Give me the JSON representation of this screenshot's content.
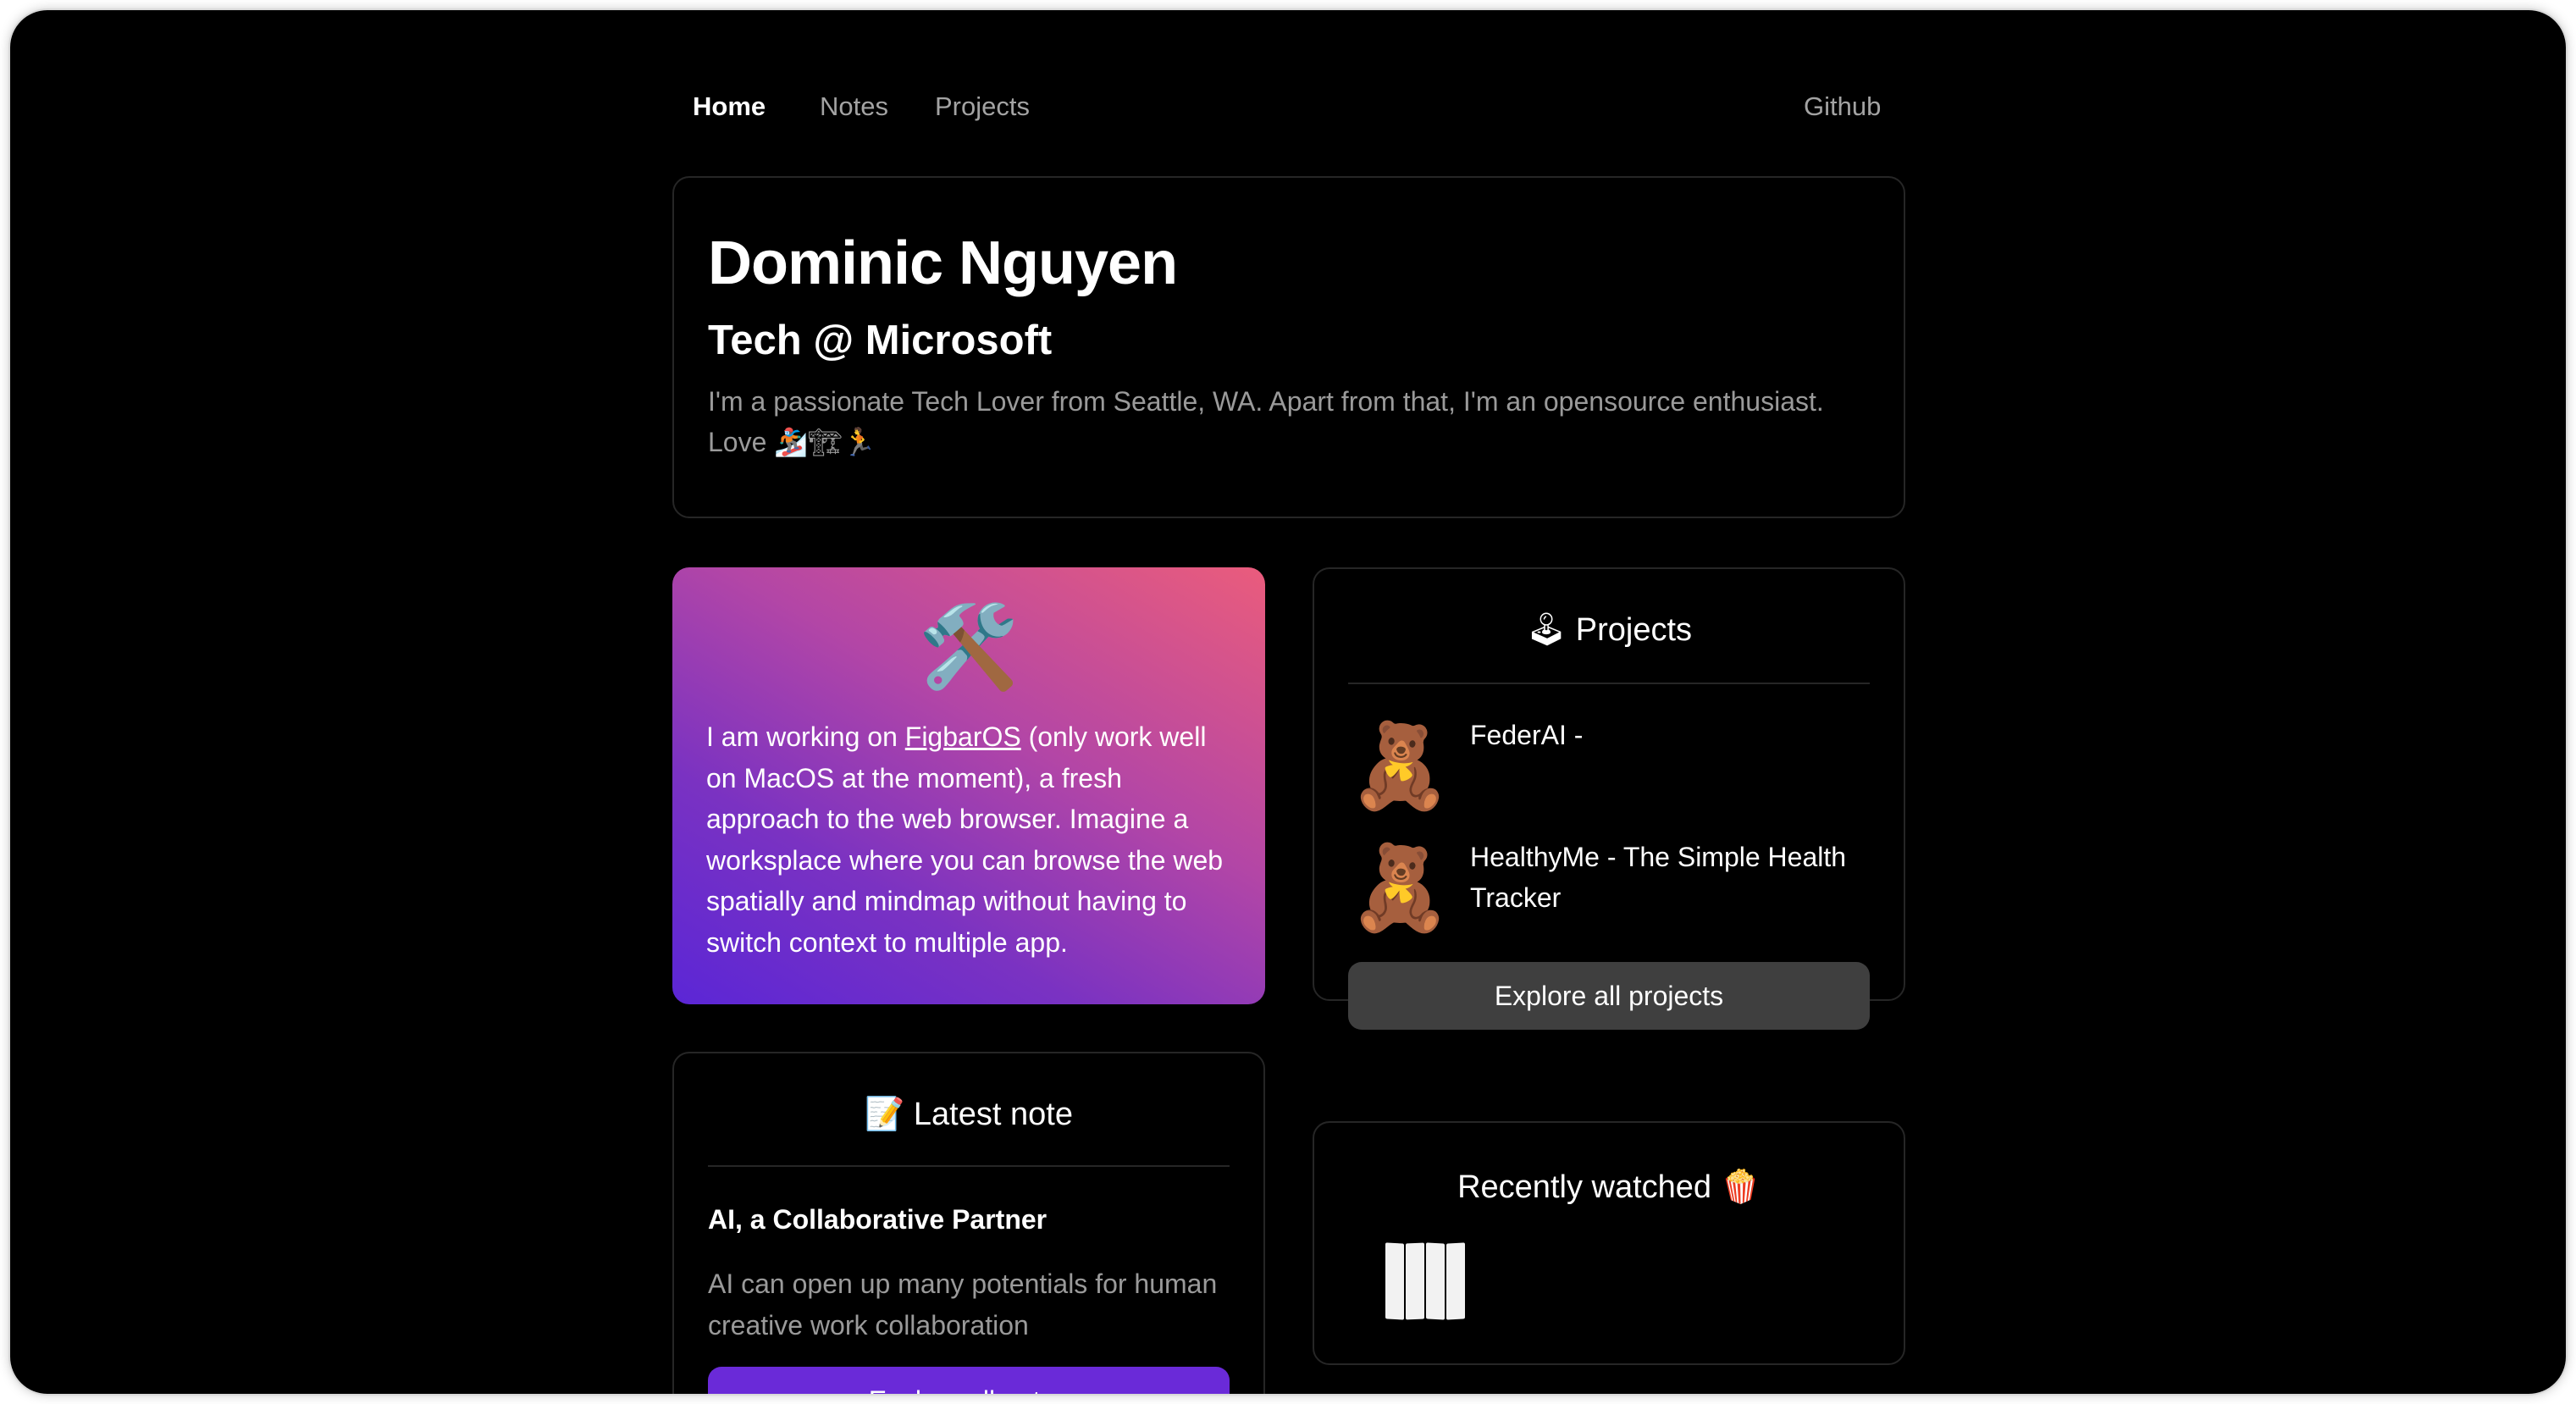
{
  "nav": {
    "links": [
      "Home",
      "Notes",
      "Projects"
    ],
    "github": "Github"
  },
  "hero": {
    "name": "Dominic Nguyen",
    "role": "Tech @ Microsoft",
    "bio": "I'm a passionate Tech Lover from Seattle, WA. Apart from that, I'm an opensource enthusiast. Love 🏂🏗🏃"
  },
  "figbar": {
    "icon": "🛠️",
    "text_before": "I am working on ",
    "link": "FigbarOS",
    "text_after": " (only work well on MacOS at the moment), a fresh approach to the web browser. Imagine a worksplace where you can browse the web spatially and mindmap without having to switch context to multiple app.",
    "gradient": [
      "#5b26d6",
      "#ea5c7c"
    ]
  },
  "projects": {
    "title": "🕹 Projects",
    "items": [
      {
        "icon": "🧸",
        "name": "FederAI -"
      },
      {
        "icon": "🧸",
        "name": "HealthyMe - The Simple Health Tracker"
      }
    ],
    "button": "Explore all projects"
  },
  "note": {
    "title": "📝 Latest note",
    "headline": "AI, a Collaborative Partner",
    "excerpt": "AI can open up many potentials for human creative work collaboration",
    "button": "Explore all notes"
  },
  "watched": {
    "title": "Recently watched 🍿"
  },
  "colors": {
    "background": "#000000",
    "card_border": "#262626",
    "muted_text": "#9a9a9a",
    "button_gray": "#3f3f3f",
    "button_purple": "#6a2ad8"
  }
}
